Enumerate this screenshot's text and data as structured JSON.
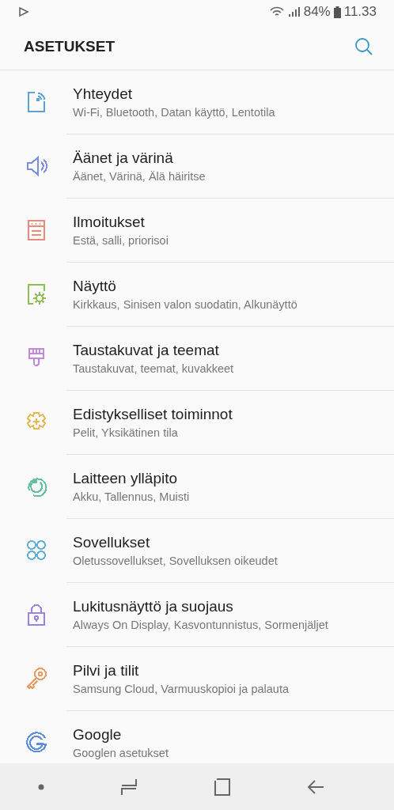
{
  "status_bar": {
    "battery": "84%",
    "time": "11.33"
  },
  "header": {
    "title": "ASETUKSET"
  },
  "settings": [
    {
      "title": "Yhteydet",
      "subtitle": "Wi-Fi, Bluetooth, Datan käyttö, Lentotila",
      "color": "#5aa3d6"
    },
    {
      "title": "Äänet ja värinä",
      "subtitle": "Äänet, Värinä, Älä häiritse",
      "color": "#7b8ee0"
    },
    {
      "title": "Ilmoitukset",
      "subtitle": "Estä, salli, priorisoi",
      "color": "#ea8a7a"
    },
    {
      "title": "Näyttö",
      "subtitle": "Kirkkaus, Sinisen valon suodatin, Alkunäyttö",
      "color": "#8fbf4f"
    },
    {
      "title": "Taustakuvat ja teemat",
      "subtitle": "Taustakuvat, teemat, kuvakkeet",
      "color": "#c08ad8"
    },
    {
      "title": "Edistykselliset toiminnot",
      "subtitle": "Pelit, Yksikätinen tila",
      "color": "#e8b850"
    },
    {
      "title": "Laitteen ylläpito",
      "subtitle": "Akku, Tallennus, Muisti",
      "color": "#62bfa0"
    },
    {
      "title": "Sovellukset",
      "subtitle": "Oletussovellukset, Sovelluksen oikeudet",
      "color": "#5ab0d8"
    },
    {
      "title": "Lukitusnäyttö ja suojaus",
      "subtitle": "Always On Display, Kasvontunnistus, Sormenjäljet",
      "color": "#9a84e0"
    },
    {
      "title": "Pilvi ja tilit",
      "subtitle": "Samsung Cloud, Varmuuskopioi ja palauta",
      "color": "#ee9a5e"
    },
    {
      "title": "Google",
      "subtitle": "Googlen asetukset",
      "color": "#5a8ee0"
    }
  ]
}
